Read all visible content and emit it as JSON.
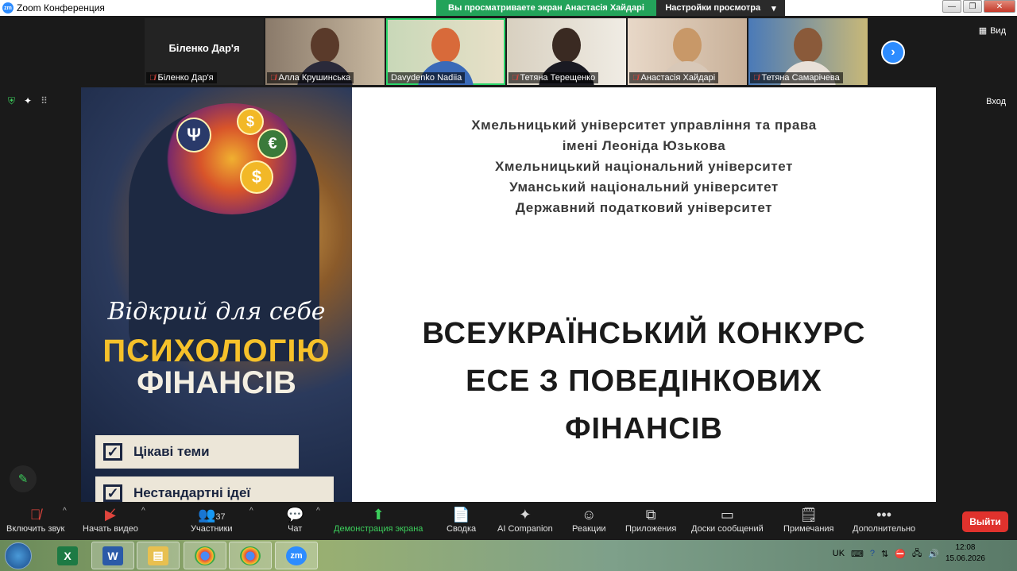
{
  "window": {
    "title": "Zoom Конференция",
    "logo": "zm"
  },
  "share_banner": {
    "text": "Вы просматриваете экран Анастасія Хайдарі"
  },
  "view_settings": {
    "label": "Настройки просмотра",
    "caret": "▾"
  },
  "top_right": {
    "view_label": "Вид",
    "exit_label": "Вход"
  },
  "participants_strip": [
    {
      "name": "Біленко Дар'я",
      "name_only": "Біленко Дар'я",
      "muted": true
    },
    {
      "name": "Алла Крушинська",
      "muted": true
    },
    {
      "name": "Davydenko Nadiia",
      "muted": false,
      "speaking": true
    },
    {
      "name": "Тетяна Терещенко",
      "muted": true
    },
    {
      "name": "Анастасія Хайдарі",
      "muted": true
    },
    {
      "name": "Тетяна Самарічева",
      "muted": true
    }
  ],
  "slide": {
    "poster": {
      "script_line": "Відкрий для себе",
      "big_line_1": "ПСИХОЛОГІЮ",
      "big_line_2": "ФІНАНСІВ",
      "checks": [
        "Цікаві теми",
        "Нестандартні ідеї"
      ],
      "coin_symbols": [
        "Ψ",
        "$",
        "€",
        "$"
      ]
    },
    "universities": [
      "Хмельницький університет управління та права",
      "імені Леоніда Юзькова",
      "Хмельницький національний університет",
      "Уманський національний університет",
      "Державний податковий університет"
    ],
    "contest_lines": [
      "ВСЕУКРАЇНСЬКИЙ КОНКУРС",
      "ЕСЕ З ПОВЕДІНКОВИХ",
      "ФІНАНСІВ"
    ]
  },
  "toolbar": {
    "unmute": "Включить звук",
    "start_video": "Начать видео",
    "participants": "Участники",
    "participants_count": "37",
    "chat": "Чат",
    "share": "Демонстрация экрана",
    "summary": "Сводка",
    "ai": "AI Companion",
    "reactions": "Реакции",
    "apps": "Приложения",
    "whiteboards": "Доски сообщений",
    "notes": "Примечания",
    "more": "Дополнительно",
    "leave": "Выйти"
  },
  "taskbar": {
    "apps": [
      "excel",
      "word",
      "explorer",
      "chrome",
      "chrome-profile",
      "zoom"
    ],
    "lang": "UK",
    "time": "12:08",
    "date": "15.06.2026"
  }
}
